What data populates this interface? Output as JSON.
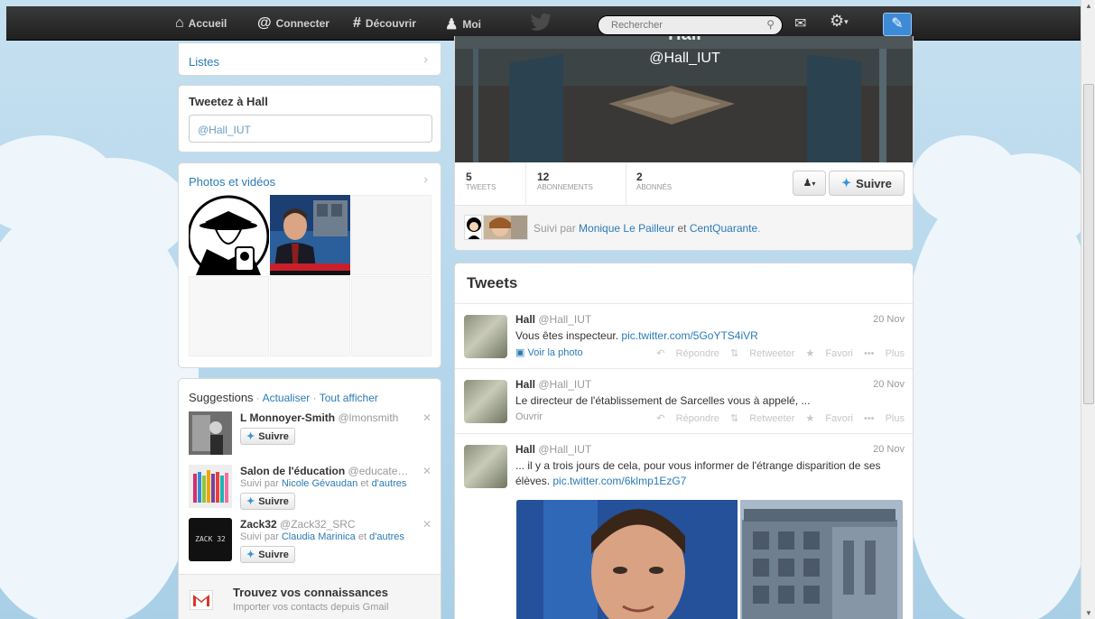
{
  "nav": {
    "home_label": "Accueil",
    "connect_label": "Connecter",
    "discover_label": "Découvrir",
    "me_label": "Moi",
    "search_placeholder": "Rechercher"
  },
  "left": {
    "lists_label": "Listes",
    "tweet_to_title": "Tweetez à Hall",
    "tweet_to_value": "@Hall_IUT",
    "photos_title": "Photos et vidéos",
    "suggestions_title": "Suggestions",
    "refresh_label": "Actualiser",
    "show_all_label": "Tout afficher",
    "follow_label": "Suivre",
    "suggestions": [
      {
        "name": "L Monnoyer-Smith",
        "handle": "@lmonsmith",
        "followed_by": "",
        "followed_by_link": "",
        "and": "",
        "others": ""
      },
      {
        "name": "Salon de l'éducation",
        "handle": "@educate…",
        "followed_by": "Suivi par",
        "followed_by_link": "Nicole Gévaudan",
        "and": "et",
        "others": "d'autres"
      },
      {
        "name": "Zack32",
        "handle": "@Zack32_SRC",
        "followed_by": "Suivi par",
        "followed_by_link": "Claudia Marinica",
        "and": "et",
        "others": "d'autres",
        "avatar_text": "ZACK 32"
      }
    ],
    "find_title": "Trouvez vos connaissances",
    "find_sub": "Importer vos contacts depuis Gmail"
  },
  "profile": {
    "name": "Hall",
    "handle": "@Hall_IUT",
    "tweets_count": "5",
    "tweets_label": "TWEETS",
    "following_count": "12",
    "following_label": "ABONNEMENTS",
    "followers_count": "2",
    "followers_label": "ABONNÉS",
    "follow_label": "Suivre",
    "followed_by": "Suivi par",
    "followed_by_1": "Monique Le Pailleur",
    "followed_and": "et",
    "followed_by_2": "CentQuarante",
    "followed_end": "."
  },
  "tweets_title": "Tweets",
  "tweets": [
    {
      "name": "Hall",
      "handle": "@Hall_IUT",
      "date": "20 Nov",
      "text": "Vous êtes inspecteur.",
      "link": "pic.twitter.com/5GoYTS4iVR",
      "extra": "Voir la photo"
    },
    {
      "name": "Hall",
      "handle": "@Hall_IUT",
      "date": "20 Nov",
      "text": "Le directeur de l'établissement de Sarcelles vous à appelé, ...",
      "link": "",
      "extra": "Ouvrir"
    },
    {
      "name": "Hall",
      "handle": "@Hall_IUT",
      "date": "20 Nov",
      "text": "... il y a trois jours de cela, pour vous informer de l'étrange disparition de ses élèves.",
      "link": "pic.twitter.com/6klmp1EzG7",
      "extra": ""
    }
  ],
  "actions": {
    "reply": "Répondre",
    "retweet": "Retweeter",
    "favorite": "Favori",
    "more": "Plus"
  }
}
